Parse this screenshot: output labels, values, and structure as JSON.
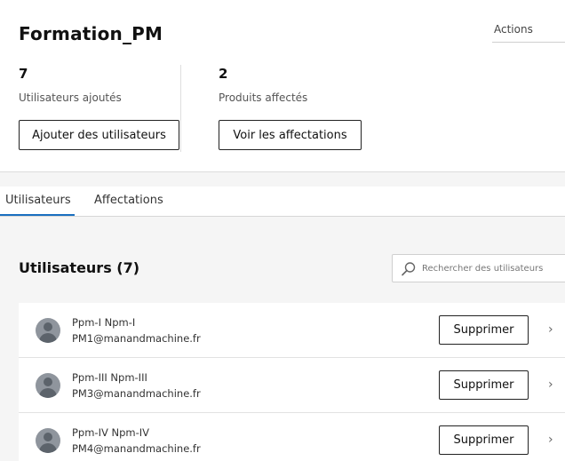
{
  "header": {
    "title": "Formation_PM",
    "actions_label": "Actions"
  },
  "stats": {
    "users": {
      "count": "7",
      "label": "Utilisateurs ajoutés",
      "button": "Ajouter des utilisateurs"
    },
    "products": {
      "count": "2",
      "label": "Produits affectés",
      "button": "Voir les affectations"
    }
  },
  "tabs": [
    {
      "label": "Utilisateurs",
      "active": true
    },
    {
      "label": "Affectations",
      "active": false
    }
  ],
  "users_section": {
    "title": "Utilisateurs (7)",
    "search_placeholder": "Rechercher des utilisateurs",
    "remove_label": "Supprimer",
    "chevron": "›",
    "rows": [
      {
        "name": "Ppm-I Npm-I",
        "email": "PM1@manandmachine.fr"
      },
      {
        "name": "Ppm-III Npm-III",
        "email": "PM3@manandmachine.fr"
      },
      {
        "name": "Ppm-IV Npm-IV",
        "email": "PM4@manandmachine.fr"
      }
    ]
  },
  "colors": {
    "tab_accent": "#1a6fbf",
    "avatar": "#8f959d"
  },
  "icons": [
    "search-icon",
    "user-avatar-icon",
    "chevron-right-icon"
  ]
}
